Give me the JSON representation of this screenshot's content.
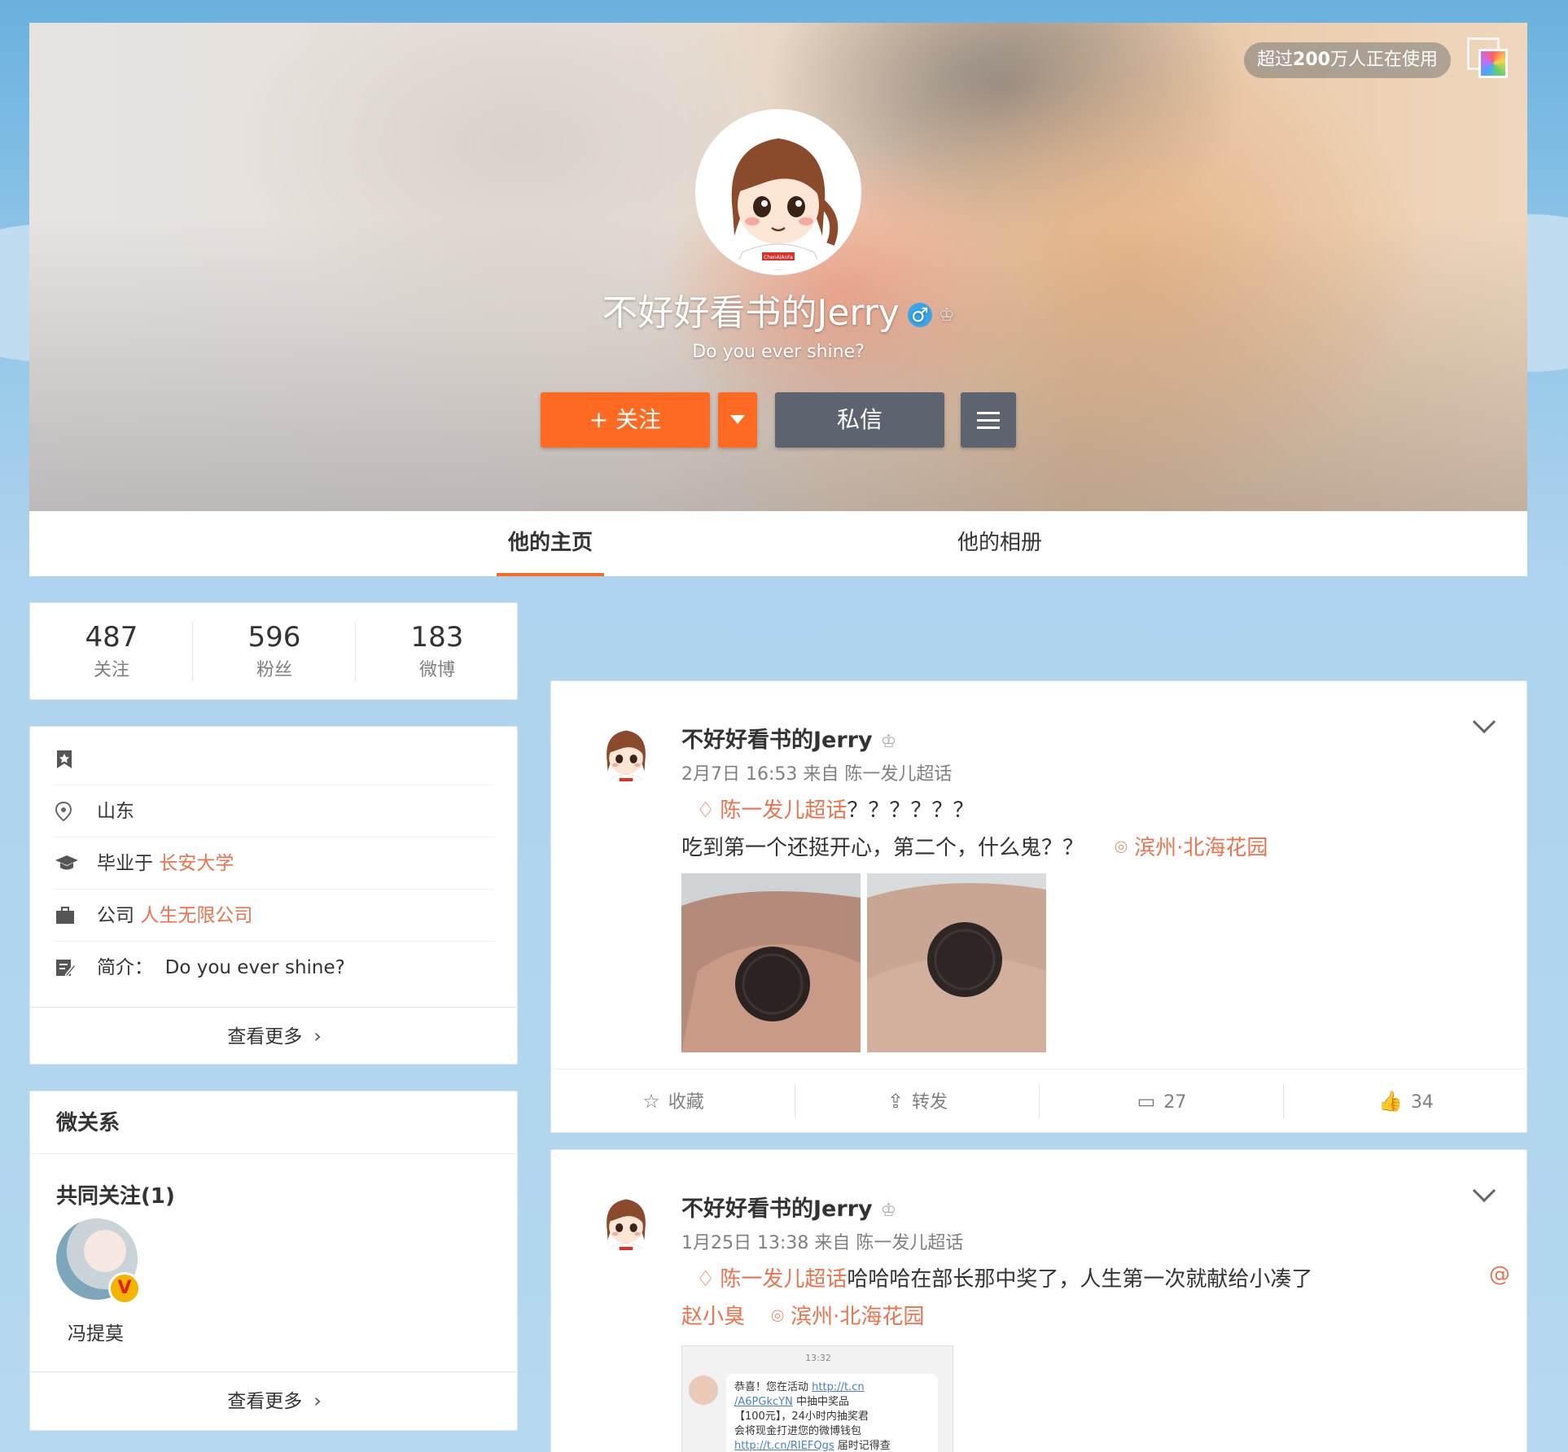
{
  "cover": {
    "users_pill_prefix": "超过",
    "users_pill_bold": "200",
    "users_pill_suffix": "万人正在使用",
    "avatar_shirt_text": "ChenAiAnFa"
  },
  "profile": {
    "name": "不好好看书的Jerry",
    "gender_symbol": "♂",
    "crown_symbol": "♔",
    "bio": "Do you ever shine?",
    "follow_label": "+ 关注",
    "message_label": "私信"
  },
  "tabs": [
    "他的主页",
    "他的相册"
  ],
  "stats": [
    {
      "num": "487",
      "label": "关注"
    },
    {
      "num": "596",
      "label": "粉丝"
    },
    {
      "num": "183",
      "label": "微博"
    }
  ],
  "info": {
    "location": "山东",
    "school_prefix": "毕业于",
    "school": "长安大学",
    "company_prefix": "公司",
    "company": "人生无限公司",
    "intro_prefix": "简介：",
    "intro": "Do you ever shine?",
    "more": "查看更多"
  },
  "relations": {
    "title": "微关系",
    "common_label": "共同关注(1)",
    "user_name": "冯提莫",
    "v_badge": "V",
    "more": "查看更多"
  },
  "posts": [
    {
      "name": "不好好看书的Jerry",
      "meta": "2月7日 16:53 来自 陈一发儿超话",
      "topic": "陈一发儿超话",
      "topic_tail": "？？？？？？",
      "line2": "吃到第一个还挺开心，第二个，什么鬼？？",
      "location": "滨州·北海花园",
      "actions": {
        "fav": "收藏",
        "repost": "转发",
        "comments": "27",
        "likes": "34"
      }
    },
    {
      "name": "不好好看书的Jerry",
      "meta": "1月25日 13:38 来自 陈一发儿超话",
      "topic": "陈一发儿超话",
      "topic_tail": "哈哈哈在部长那中奖了，人生第一次就献给小凑了",
      "at_symbol": "@",
      "mention": "赵小臭",
      "location": "滨州·北海花园",
      "screenshot": {
        "time": "13:32",
        "msg1": "恭喜！您在活动",
        "link1": "http://t.cn",
        "link2": "/A6PGkcYN",
        "msg2": "中抽中奖品",
        "msg3": "【100元】，24小时内抽奖君",
        "msg4": "会将现金打进您的微博钱包",
        "link3": "http://t.cn/RIEFQgs",
        "msg5": "届时记得查"
      }
    }
  ]
}
